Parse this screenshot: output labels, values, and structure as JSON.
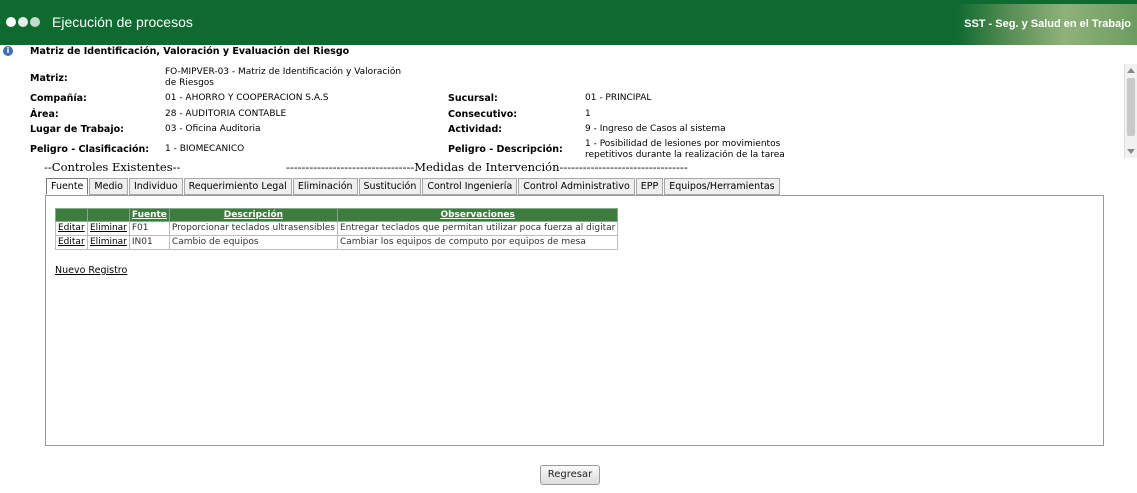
{
  "header": {
    "title": "Ejecución de procesos",
    "brand": "SST - Seg. y Salud en el Trabajo"
  },
  "page_title": "Matriz de Identificación, Valoración y Evaluación del Riesgo",
  "fields": {
    "matriz_label": "Matriz:",
    "matriz_value": "FO-MIPVER-03 - Matriz de Identificación y Valoración de Riesgos",
    "compania_label": "Compañía:",
    "compania_value": "01 - AHORRO Y COOPERACION S.A.S",
    "sucursal_label": "Sucursal:",
    "sucursal_value": "01 - PRINCIPAL",
    "area_label": "Área:",
    "area_value": "28 - AUDITORIA CONTABLE",
    "consecutivo_label": "Consecutivo:",
    "consecutivo_value": "1",
    "lugar_label": "Lugar de Trabajo:",
    "lugar_value": "03 - Oficina Auditoria",
    "actividad_label": "Actividad:",
    "actividad_value": "9 - Ingreso de Casos al sistema",
    "peligro_clas_label": "Peligro - Clasificación:",
    "peligro_clas_value": "1 - BIOMECANICO",
    "peligro_desc_label": "Peligro - Descripción:",
    "peligro_desc_value": "1 - Posibilidad de lesiones por movimientos repetitivos durante la realización de la tarea"
  },
  "section_headers": {
    "controles": "--Controles Existentes--",
    "medidas": "---------------------------------Medidas de Intervención---------------------------------"
  },
  "tabs": [
    "Fuente",
    "Medio",
    "Individuo",
    "Requerimiento Legal",
    "Eliminación",
    "Sustitución",
    "Control Ingeniería",
    "Control Administrativo",
    "EPP",
    "Equipos/Herramientas"
  ],
  "table": {
    "headers": [
      "Fuente",
      "Descripción",
      "Observaciones"
    ],
    "edit_label": "Editar",
    "delete_label": "Eliminar",
    "rows": [
      {
        "fuente": "F01",
        "descripcion": "Proporcionar teclados ultrasensibles",
        "observaciones": "Entregar teclados que permitan utilizar poca fuerza al digitar"
      },
      {
        "fuente": "IN01",
        "descripcion": "Cambio de equipos",
        "observaciones": "Cambiar los equipos de computo por equipos de mesa"
      }
    ]
  },
  "nuevo_registro": "Nuevo Registro",
  "back_button": "Regresar",
  "colors": {
    "header_bg": "#0f6a30",
    "table_header_bg": "#3d7c3f"
  }
}
